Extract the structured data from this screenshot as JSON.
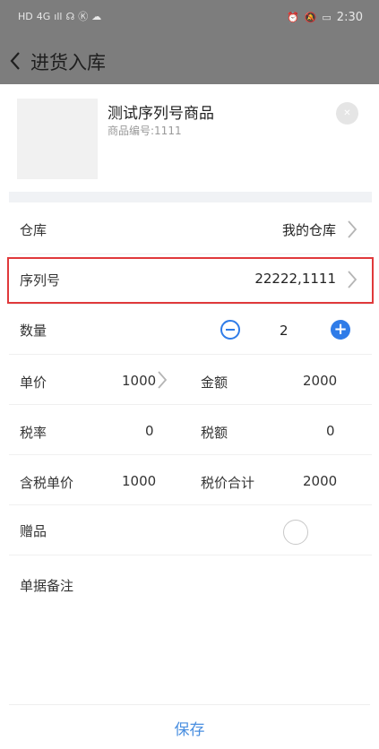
{
  "status_bar": {
    "left_icons": [
      "HD",
      "4G",
      "ıll",
      "☊",
      "Ⓚ",
      "☁"
    ],
    "right_icons": [
      "⏰",
      "🔕",
      "▭"
    ],
    "time": "2:30"
  },
  "header": {
    "title": "进货入库"
  },
  "product": {
    "name": "测试序列号商品",
    "code": "商品编号:1111"
  },
  "rows": {
    "warehouse": {
      "label": "仓库",
      "value": "我的仓库"
    },
    "serial": {
      "label": "序列号",
      "value": "22222,1111"
    },
    "quantity": {
      "label": "数量",
      "value": "2"
    },
    "unit_price": {
      "label": "单价",
      "value": "1000"
    },
    "amount": {
      "label": "金额",
      "value": "2000"
    },
    "tax_rate": {
      "label": "税率",
      "value": "0"
    },
    "tax_amount": {
      "label": "税额",
      "value": "0"
    },
    "tax_incl_price": {
      "label": "含税单价",
      "value": "1000"
    },
    "total_with_tax": {
      "label": "税价合计",
      "value": "2000"
    },
    "gift": {
      "label": "赠品"
    },
    "remark": {
      "label": "单据备注",
      "value": ""
    }
  },
  "footer": {
    "save_label": "保存"
  },
  "colors": {
    "accent": "#2f7ce8",
    "highlight": "#e0393b",
    "header_bg": "#7d7d7d"
  }
}
